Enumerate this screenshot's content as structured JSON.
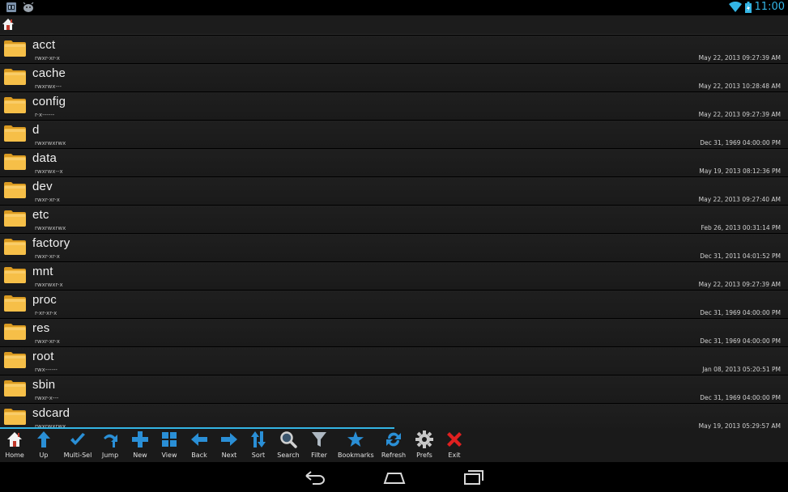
{
  "status": {
    "time": "11:00"
  },
  "files": [
    {
      "name": "acct",
      "perm": "rwxr-xr-x",
      "date": "May 22, 2013 09:27:39 AM"
    },
    {
      "name": "cache",
      "perm": "rwxrwx---",
      "date": "May 22, 2013 10:28:48 AM"
    },
    {
      "name": "config",
      "perm": "r-x------",
      "date": "May 22, 2013 09:27:39 AM"
    },
    {
      "name": "d",
      "perm": "rwxrwxrwx",
      "date": "Dec 31, 1969 04:00:00 PM"
    },
    {
      "name": "data",
      "perm": "rwxrwx--x",
      "date": "May 19, 2013 08:12:36 PM"
    },
    {
      "name": "dev",
      "perm": "rwxr-xr-x",
      "date": "May 22, 2013 09:27:40 AM"
    },
    {
      "name": "etc",
      "perm": "rwxrwxrwx",
      "date": "Feb 26, 2013 00:31:14 PM"
    },
    {
      "name": "factory",
      "perm": "rwxr-xr-x",
      "date": "Dec 31, 2011 04:01:52 PM"
    },
    {
      "name": "mnt",
      "perm": "rwxrwxr-x",
      "date": "May 22, 2013 09:27:39 AM"
    },
    {
      "name": "proc",
      "perm": "r-xr-xr-x",
      "date": "Dec 31, 1969 04:00:00 PM"
    },
    {
      "name": "res",
      "perm": "rwxr-xr-x",
      "date": "Dec 31, 1969 04:00:00 PM"
    },
    {
      "name": "root",
      "perm": "rwx------",
      "date": "Jan 08, 2013 05:20:51 PM"
    },
    {
      "name": "sbin",
      "perm": "rwxr-x---",
      "date": "Dec 31, 1969 04:00:00 PM"
    },
    {
      "name": "sdcard",
      "perm": "rwxrwxrwx",
      "date": "May 19, 2013 05:29:57 AM"
    }
  ],
  "toolbar": [
    {
      "label": "Home",
      "icon": "home-icon"
    },
    {
      "label": "Up",
      "icon": "up-arrow-icon"
    },
    {
      "label": "Multi-Sel",
      "icon": "checkmark-icon"
    },
    {
      "label": "Jump",
      "icon": "jump-arrow-icon"
    },
    {
      "label": "New",
      "icon": "plus-icon"
    },
    {
      "label": "View",
      "icon": "grid-icon"
    },
    {
      "label": "Back",
      "icon": "left-arrow-icon"
    },
    {
      "label": "Next",
      "icon": "right-arrow-icon"
    },
    {
      "label": "Sort",
      "icon": "sort-icon"
    },
    {
      "label": "Search",
      "icon": "magnifier-icon"
    },
    {
      "label": "Filter",
      "icon": "funnel-icon"
    },
    {
      "label": "Bookmarks",
      "icon": "star-icon"
    },
    {
      "label": "Refresh",
      "icon": "refresh-icon"
    },
    {
      "label": "Prefs",
      "icon": "gear-icon"
    },
    {
      "label": "Exit",
      "icon": "close-icon"
    }
  ],
  "colors": {
    "accent": "#33b5e5",
    "folder": "#f5b83d",
    "toolbar_icon": "#2a8fd6",
    "exit": "#e02020"
  }
}
